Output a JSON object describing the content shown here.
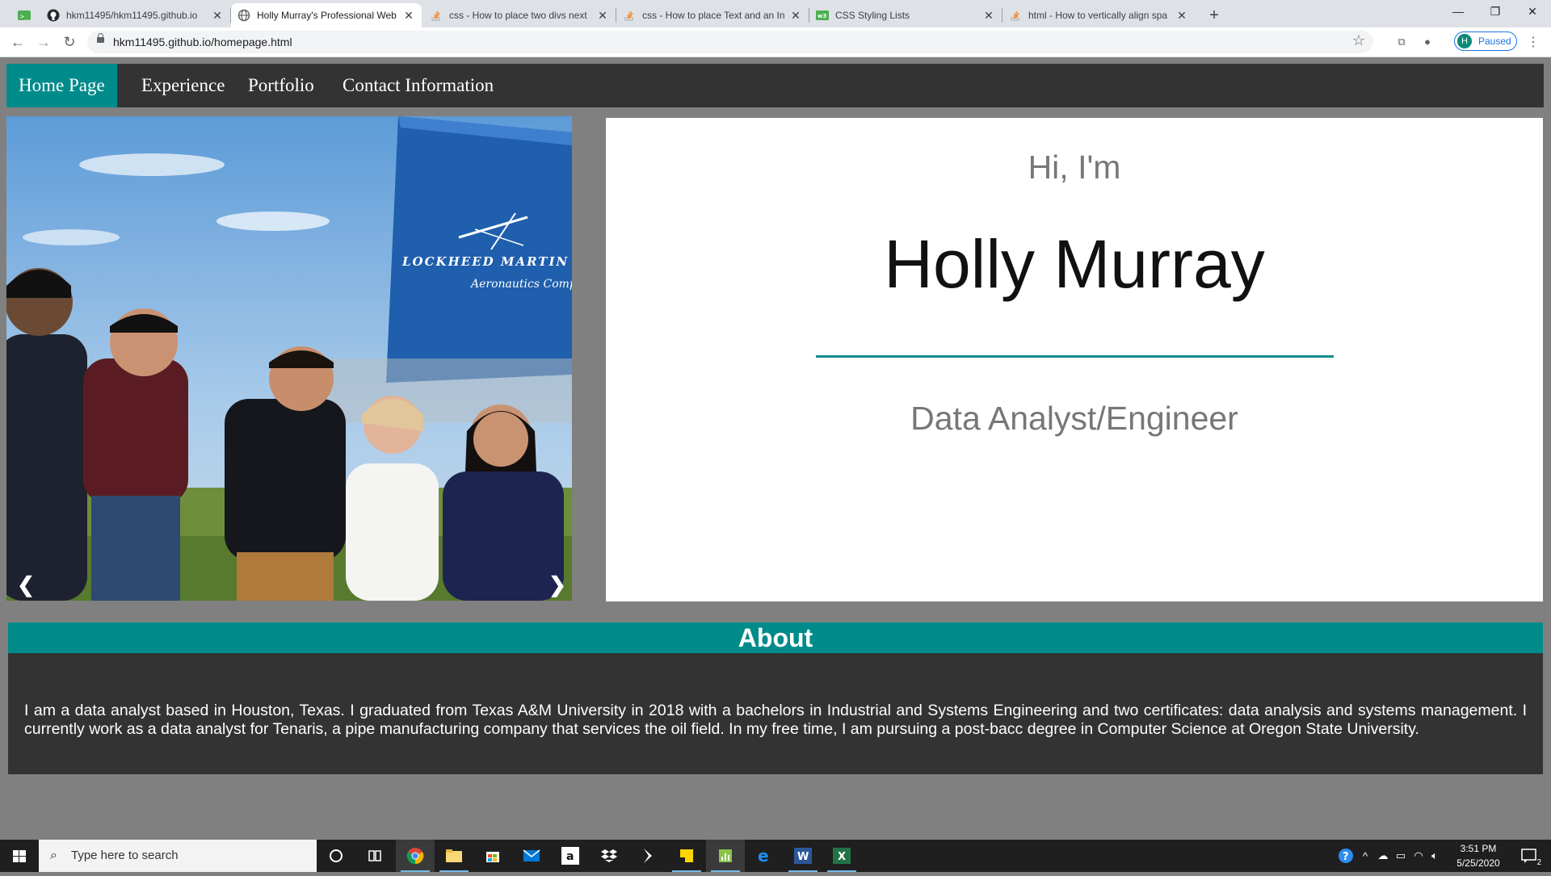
{
  "browser": {
    "tabs": [
      {
        "title": "",
        "favicon": "green-cli-icon",
        "active": false
      },
      {
        "title": "hkm11495/hkm11495.github.io",
        "favicon": "github-icon",
        "active": false
      },
      {
        "title": "Holly Murray's Professional Web",
        "favicon": "globe-icon",
        "active": true
      },
      {
        "title": "css - How to place two divs next",
        "favicon": "stackoverflow-icon",
        "active": false
      },
      {
        "title": "css - How to place Text and an In",
        "favicon": "stackoverflow-icon",
        "active": false
      },
      {
        "title": "CSS Styling Lists",
        "favicon": "w3schools-icon",
        "active": false
      },
      {
        "title": "html - How to vertically align spa",
        "favicon": "stackoverflow-icon",
        "active": false
      }
    ],
    "url": "hkm11495.github.io/homepage.html",
    "profile": {
      "initial": "H",
      "status": "Paused"
    }
  },
  "site": {
    "nav": [
      "Home Page",
      "Experience",
      "Portfolio",
      "Contact Information"
    ],
    "active_nav": "Home Page",
    "slideshow": {
      "prev": "❮",
      "next": "❯",
      "sign_line1": "LOCKHEED MARTIN",
      "sign_line2": "Aeronautics Compan"
    },
    "intro": {
      "greeting": "Hi, I'm",
      "name": "Holly Murray",
      "role": "Data Analyst/Engineer"
    },
    "about": {
      "heading": "About",
      "text": "I am a data analyst based in Houston, Texas. I graduated from Texas A&M University in 2018 with a bachelors in Industrial and Systems Engineering and two certificates: data analysis and systems management. I currently work as a data analyst for Tenaris, a pipe manufacturing company that services the oil field. In my free time, I am pursuing a post-bacc degree in Computer Science at Oregon State University."
    }
  },
  "taskbar": {
    "search_placeholder": "Type here to search",
    "time": "3:51 PM",
    "date": "5/25/2020",
    "notification_count": "2",
    "accent": "#008b8b"
  }
}
